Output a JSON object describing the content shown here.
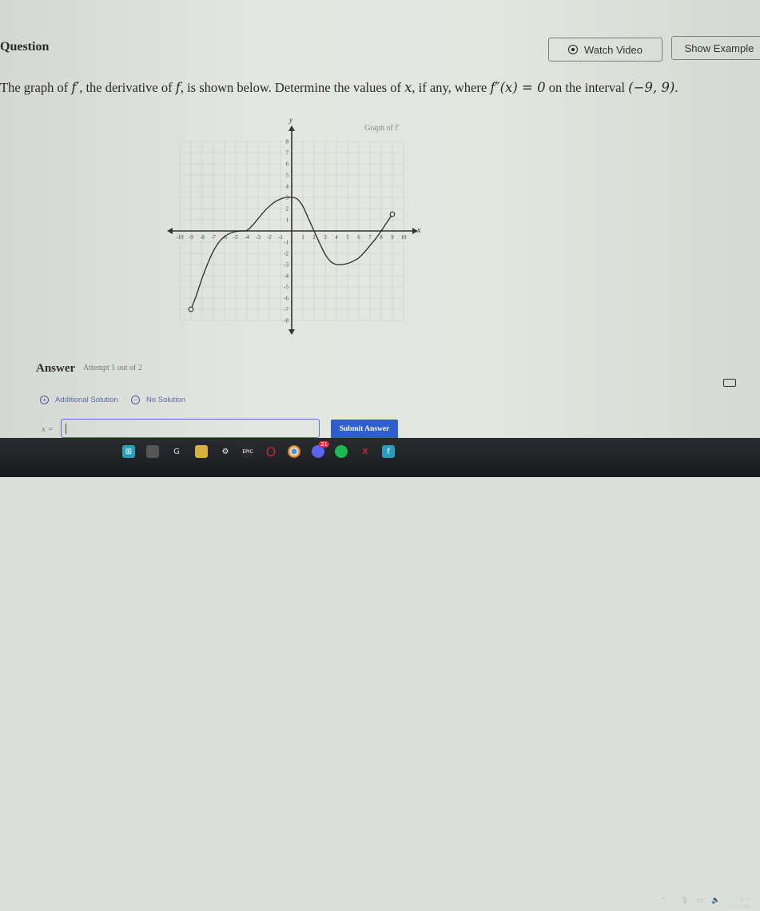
{
  "header": {
    "title": "Question",
    "watch_video_label": "Watch Video",
    "show_example_label": "Show Example"
  },
  "question": {
    "part1": "The graph of ",
    "fprime": "f′",
    "part2": ", the derivative of ",
    "f": "f",
    "part3": ", is shown below. Determine the values of ",
    "x": "x",
    "part4": ", if any, where ",
    "fdouble": "f″(x) = 0",
    "part5": " on the interval ",
    "interval": "(−9, 9)",
    "part6": "."
  },
  "chart_data": {
    "type": "line",
    "title": "Graph of f′",
    "xlabel": "x",
    "ylabel": "y",
    "xlim": [
      -10,
      10
    ],
    "ylim": [
      -8,
      8
    ],
    "grid": true,
    "x_ticks": [
      -10,
      -9,
      -8,
      -7,
      -6,
      -5,
      -4,
      -3,
      -2,
      -1,
      1,
      2,
      3,
      4,
      5,
      6,
      7,
      8,
      9,
      10
    ],
    "y_ticks": [
      -8,
      -7,
      -6,
      -5,
      -4,
      -3,
      -2,
      -1,
      1,
      2,
      3,
      4,
      5,
      6,
      7,
      8
    ],
    "series": [
      {
        "name": "f′",
        "points": [
          [
            -9,
            -7
          ],
          [
            -8.5,
            -5.7
          ],
          [
            -8,
            -4.2
          ],
          [
            -7.5,
            -2.9
          ],
          [
            -7,
            -1.8
          ],
          [
            -6.5,
            -1.0
          ],
          [
            -6,
            -0.5
          ],
          [
            -5.5,
            -0.2
          ],
          [
            -5,
            -0.05
          ],
          [
            -4.5,
            0
          ],
          [
            -4,
            0.05
          ],
          [
            -3.5,
            0.5
          ],
          [
            -3,
            1.1
          ],
          [
            -2.5,
            1.7
          ],
          [
            -2,
            2.2
          ],
          [
            -1.5,
            2.6
          ],
          [
            -1,
            2.85
          ],
          [
            -0.5,
            3.0
          ],
          [
            0,
            3
          ],
          [
            0.5,
            2.85
          ],
          [
            1,
            2.2
          ],
          [
            1.5,
            1.1
          ],
          [
            2,
            0
          ],
          [
            2.5,
            -1.1
          ],
          [
            3,
            -2.1
          ],
          [
            3.5,
            -2.75
          ],
          [
            4,
            -3
          ],
          [
            4.5,
            -3
          ],
          [
            5,
            -2.9
          ],
          [
            5.5,
            -2.7
          ],
          [
            6,
            -2.4
          ],
          [
            6.5,
            -1.9
          ],
          [
            7,
            -1.3
          ],
          [
            7.5,
            -0.7
          ],
          [
            8,
            0
          ],
          [
            8.5,
            0.75
          ],
          [
            9,
            1.5
          ]
        ],
        "open_endpoints": [
          [
            -9,
            -7
          ],
          [
            9,
            1.5
          ]
        ]
      }
    ]
  },
  "answer": {
    "label": "Answer",
    "attempt": "Attempt 1 out of 2",
    "additional_solution": "Additional Solution",
    "no_solution": "No Solution",
    "x_prefix": "x =",
    "input_value": "",
    "submit_label": "Submit Answer"
  },
  "taskbar": {
    "apps": [
      "start",
      "task-view",
      "logitech-g-hub",
      "file-explorer",
      "steelseries",
      "epic-games",
      "opera-gx",
      "chrome",
      "discord",
      "spotify",
      "creative-cloud-x",
      "app-tile"
    ],
    "discord_badge": "21",
    "clock_time": "7:37 P",
    "clock_date": "12/11/20"
  }
}
